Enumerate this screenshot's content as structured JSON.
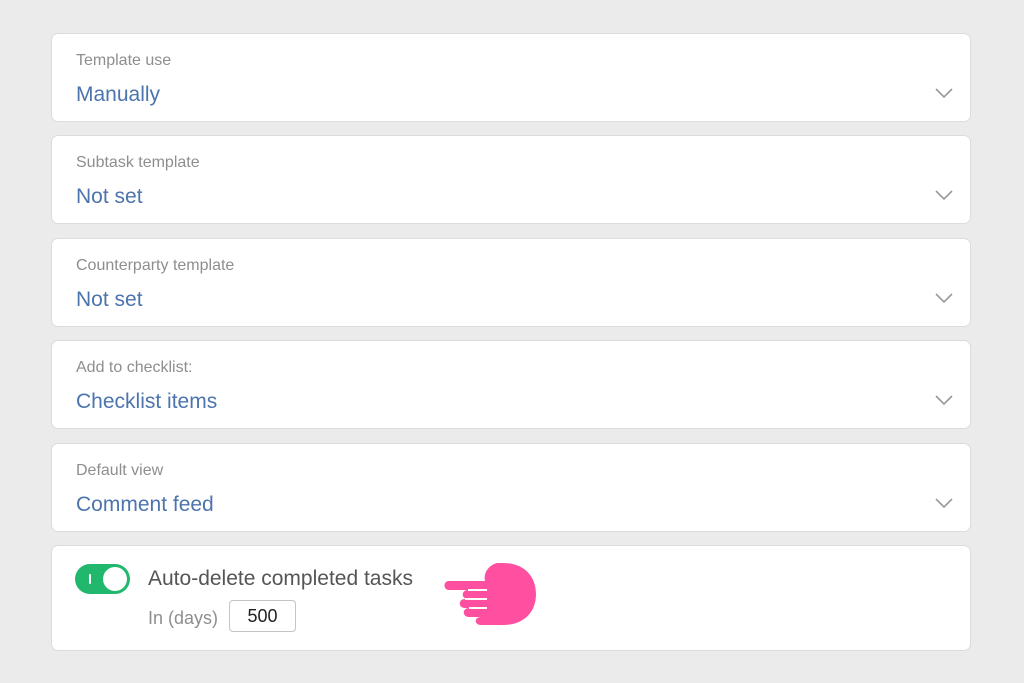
{
  "fields": [
    {
      "label": "Template use",
      "value": "Manually"
    },
    {
      "label": "Subtask template",
      "value": "Not set"
    },
    {
      "label": "Counterparty template",
      "value": "Not set"
    },
    {
      "label": "Add to checklist:",
      "value": "Checklist items"
    },
    {
      "label": "Default view",
      "value": "Comment feed"
    }
  ],
  "auto_delete": {
    "label": "Auto-delete completed tasks",
    "enabled": true,
    "days_label": "In (days)",
    "days_value": "500"
  },
  "colors": {
    "background": "#ebebeb",
    "accent_text": "#4c74ad",
    "toggle_on": "#21b86d",
    "pointer_hand": "#ff4fa0"
  },
  "icons": {
    "dropdown": "chevron-down-icon",
    "pointer": "pointing-hand-icon"
  }
}
